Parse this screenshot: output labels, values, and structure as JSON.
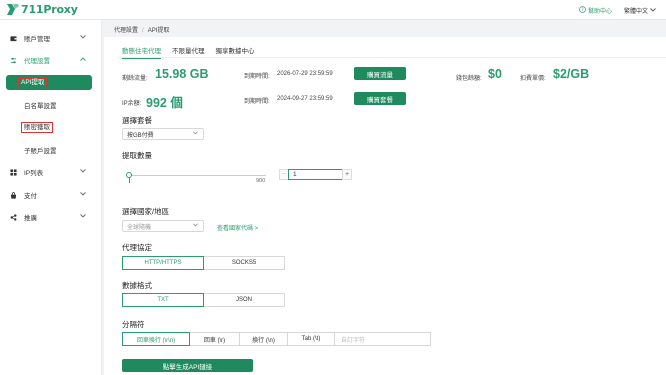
{
  "header": {
    "logo_text": "711Proxy",
    "help_label": "幫助中心",
    "language_label": "繁體中文"
  },
  "sidebar": {
    "items": [
      {
        "label": "賬戶管理",
        "icon": "wallet-icon"
      },
      {
        "label": "代理設置",
        "icon": "settings-sliders-icon"
      },
      {
        "label": "IP列表",
        "icon": "grid-icon"
      },
      {
        "label": "支付",
        "icon": "bag-icon"
      },
      {
        "label": "推廣",
        "icon": "share-icon"
      }
    ],
    "subitems": [
      "API提取",
      "白名單設置",
      "賬密獲取",
      "子賬戶設置"
    ]
  },
  "breadcrumb": {
    "parent": "代理設置",
    "current": "API提取"
  },
  "tabs": [
    "動態住宅代理",
    "不限量代理",
    "獨享數據中心"
  ],
  "stats": {
    "remaining_traffic_label": "剩餘流量:",
    "remaining_traffic_value": "15.98 GB",
    "traffic_expiry_label": "到期時間:",
    "traffic_expiry_value": "2026-07-29 23:59:59",
    "buy_traffic_button": "購買流量",
    "wallet_label": "錢包餘額:",
    "wallet_value": "$0",
    "deduct_price_label": "扣費單價:",
    "deduct_price_value": "$2/GB",
    "ip_remaining_label": "IP余額:",
    "ip_remaining_value": "992 個",
    "ip_expiry_label": "到期時間:",
    "ip_expiry_value": "2024-09-27 23:59:59",
    "buy_package_button": "購買套餐"
  },
  "package": {
    "label": "選擇套餐",
    "selected": "按GB付費"
  },
  "quantity": {
    "label": "提取數量",
    "slider_max": "900",
    "value": "1",
    "minus": "−",
    "plus": "+"
  },
  "region": {
    "label": "選擇國家/地區",
    "placeholder": "全球隨機",
    "view_codes": "查看國家代碼 >"
  },
  "protocol": {
    "label": "代理協定",
    "options": [
      "HTTP/HTTPS",
      "SOCKS5"
    ]
  },
  "format": {
    "label": "數據格式",
    "options": [
      "TXT",
      "JSON"
    ]
  },
  "separator": {
    "label": "分隔符",
    "options": [
      "回車換行 (\\r\\n)",
      "回車 (\\r)",
      "換行 (\\n)",
      "Tab (\\t)"
    ],
    "custom_placeholder": "自訂字符"
  },
  "generate_button": "點擊生成API鏈接",
  "colors": {
    "accent": "#2a9d6f",
    "button": "#1f8a5e"
  }
}
